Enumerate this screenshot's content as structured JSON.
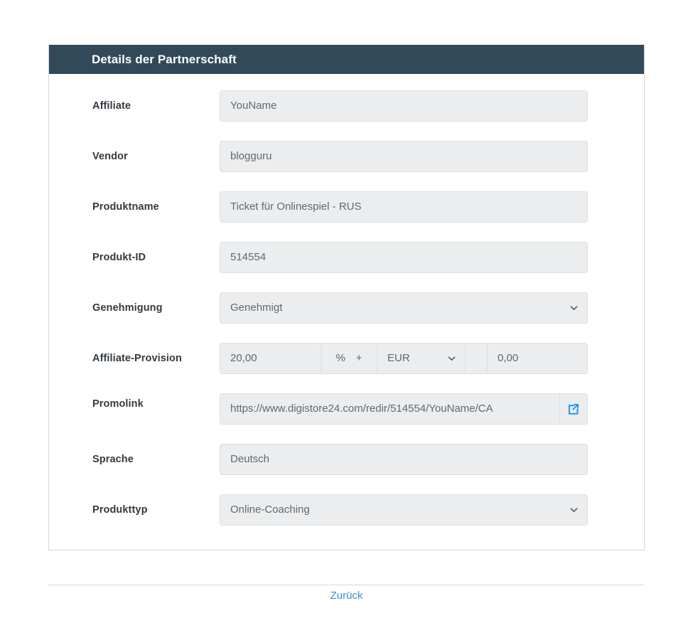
{
  "card": {
    "title": "Details der Partnerschaft"
  },
  "form": {
    "affiliate": {
      "label": "Affiliate",
      "value": "YouName"
    },
    "vendor": {
      "label": "Vendor",
      "value": "blogguru"
    },
    "product_name": {
      "label": "Produktname",
      "value": "Ticket für Onlinespiel - RUS"
    },
    "product_id": {
      "label": "Produkt-ID",
      "value": "514554"
    },
    "approval": {
      "label": "Genehmigung",
      "value": "Genehmigt",
      "chevron_icon": "chevron-down-icon"
    },
    "commission": {
      "label": "Affiliate-Provision",
      "percent_value": "20,00",
      "addon_percent": "%",
      "addon_plus": "+",
      "currency_value": "EUR",
      "currency_chevron_icon": "chevron-down-icon",
      "fixed_value": "0,00"
    },
    "promolink": {
      "label": "Promolink",
      "value": "https://www.digistore24.com/redir/514554/YouName/CA",
      "open_icon": "external-link-icon"
    },
    "language": {
      "label": "Sprache",
      "value": "Deutsch"
    },
    "product_type": {
      "label": "Produkttyp",
      "value": "Online-Coaching",
      "chevron_icon": "chevron-down-icon"
    }
  },
  "footer": {
    "back_label": "Zurück"
  },
  "colors": {
    "header_bg": "#32495a",
    "field_bg": "#ebedee",
    "field_border": "#dcdfe1",
    "link": "#3b92d4",
    "accent_icon": "#2196f3",
    "label_text": "#333a40",
    "value_text": "#63696e"
  }
}
